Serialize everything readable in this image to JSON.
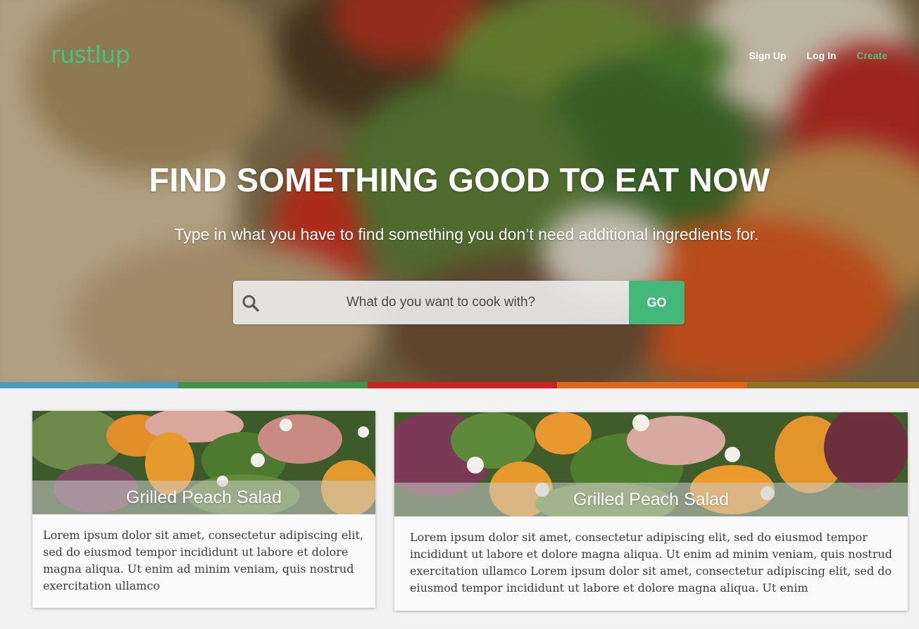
{
  "brand": {
    "logo": "rustlup",
    "accent_color": "#4cc07d"
  },
  "nav": {
    "items": [
      {
        "label": "Sign Up"
      },
      {
        "label": "Log In"
      },
      {
        "label": "Create"
      }
    ]
  },
  "hero": {
    "title": "FIND SOMETHING GOOD TO EAT NOW",
    "subtitle": "Type in what you have  to find something you don’t need additional ingredients for."
  },
  "search": {
    "icon": "search-icon",
    "placeholder": "What do you want to cook with?",
    "button_label": "GO"
  },
  "stripe_colors": [
    "#4a9bbd",
    "#3e9448",
    "#c8231f",
    "#e0661a",
    "#8d7427"
  ],
  "cards": [
    {
      "title": "Grilled Peach Salad",
      "description": "Lorem ipsum dolor sit amet, consectetur adipiscing elit, sed do eiusmod tempor incididunt ut labore et dolore magna aliqua. Ut enim ad minim veniam, quis nostrud exercitation ullamco"
    },
    {
      "title": "Grilled Peach Salad",
      "description": "Lorem ipsum dolor sit amet, consectetur adipiscing elit, sed do eiusmod tempor incididunt ut labore et dolore magna aliqua. Ut enim ad minim veniam, quis nostrud exercitation ullamco Lorem ipsum dolor sit amet, consectetur adipiscing elit, sed do eiusmod tempor incididunt ut labore et dolore magna aliqua. Ut enim"
    }
  ]
}
